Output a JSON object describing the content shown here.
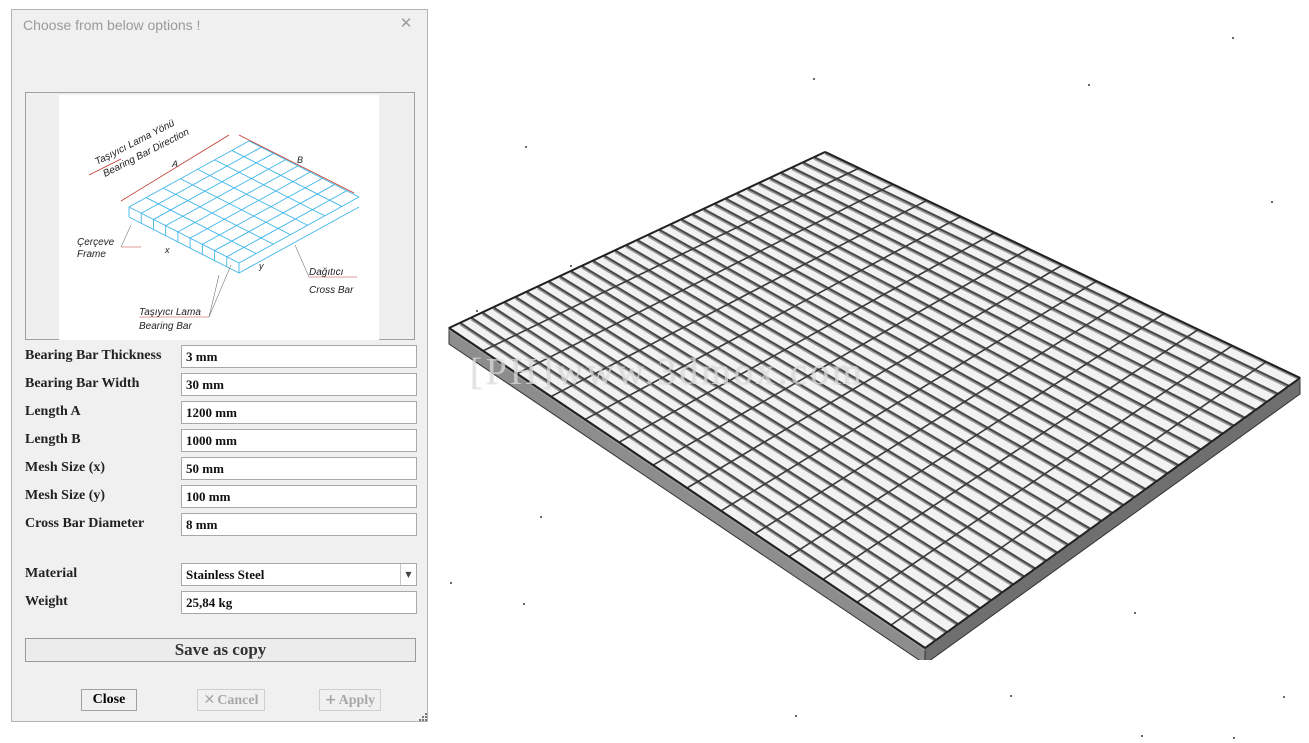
{
  "dialog": {
    "title": "Choose from below options !",
    "close_icon": "close-icon"
  },
  "diagram": {
    "direction_tr": "Taşıyıcı Lama Yönü",
    "direction_en": "Bearing Bar Direction",
    "dim_a": "A",
    "dim_b": "B",
    "frame_tr": "Çerçeve",
    "frame_en": "Frame",
    "crossbar_tr": "Dağıtıcı",
    "crossbar_en": "Cross Bar",
    "bearing_tr": "Taşıyıcı Lama",
    "bearing_en": "Bearing Bar",
    "dim_x": "x",
    "dim_y": "y",
    "accent_color": "#3fb6e8"
  },
  "fields": [
    {
      "label": "Bearing Bar Thickness",
      "value": "3 mm"
    },
    {
      "label": "Bearing Bar Width",
      "value": "30 mm"
    },
    {
      "label": "Length A",
      "value": "1200 mm"
    },
    {
      "label": "Length B",
      "value": "1000 mm"
    },
    {
      "label": "Mesh Size (x)",
      "value": "50 mm"
    },
    {
      "label": "Mesh Size (y)",
      "value": "100 mm"
    },
    {
      "label": "Cross Bar Diameter",
      "value": "8 mm"
    }
  ],
  "material": {
    "label": "Material",
    "value": "Stainless Steel"
  },
  "weight": {
    "label": "Weight",
    "value": "25,84 kg"
  },
  "buttons": {
    "save_copy": "Save as copy",
    "close": "Close",
    "cancel": "Cancel",
    "apply": "Apply"
  },
  "watermark": "[PH]www.3dmox.com"
}
